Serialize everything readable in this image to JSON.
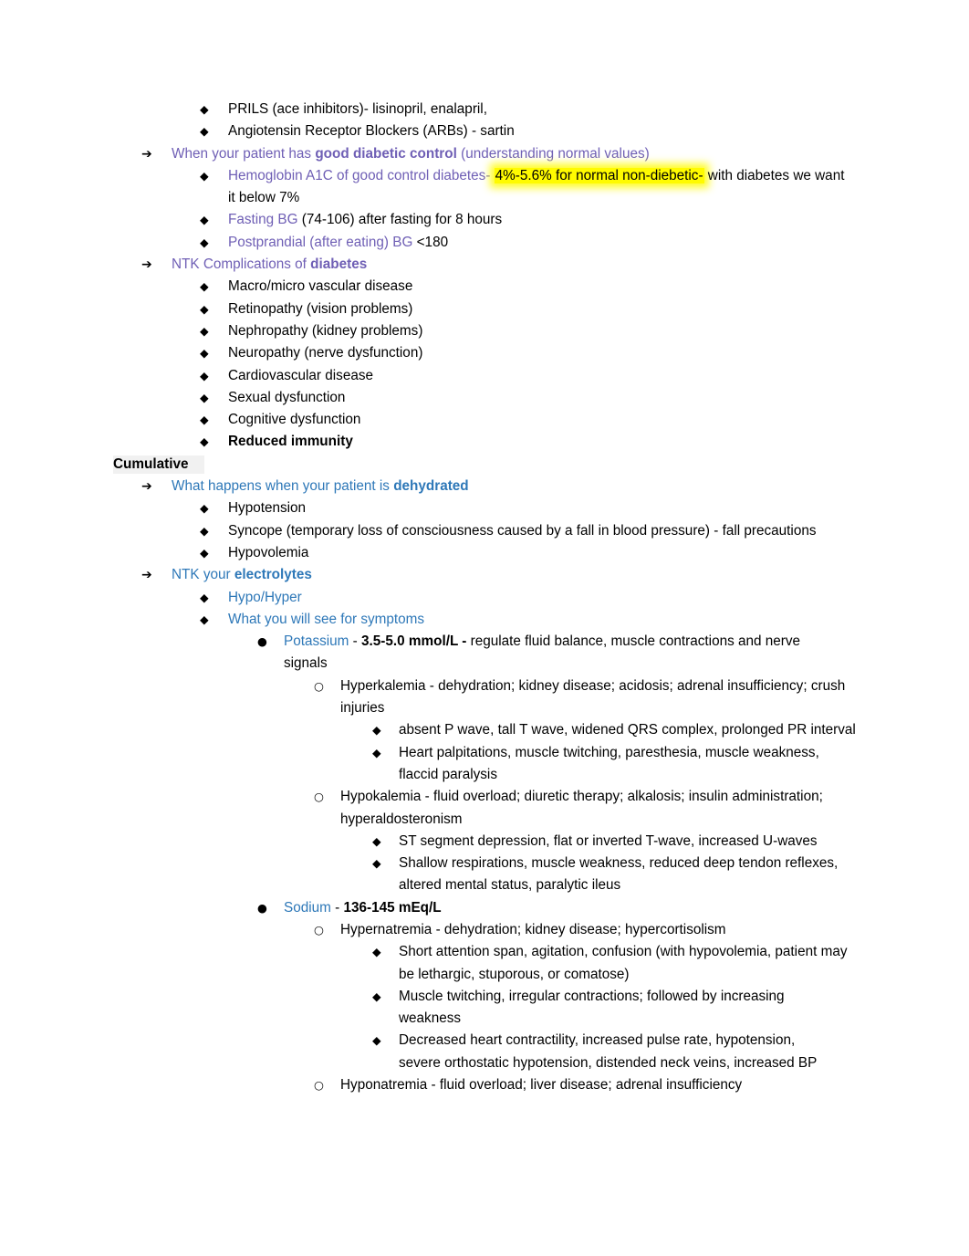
{
  "document": {
    "colors": {
      "purple": "#6f5fb5",
      "blue": "#2e78b8",
      "highlight_yellow": "#fffb00",
      "heading_shade": "#f1f1f1",
      "text": "#000000"
    },
    "markers": {
      "arrow": "➔",
      "diamond": "◆",
      "filled_circle": "●",
      "hollow_circle": "○"
    },
    "lines": {
      "prils": "PRILS (ace inhibitors)- lisinopril, enalapril,",
      "arbs": "Angiotensin Receptor Blockers (ARBs) - sartin",
      "good_control_a": "When your patient has ",
      "good_control_b": "good diabetic control",
      "good_control_c": " (understanding normal values)",
      "a1c_a": "Hemoglobin A1C of good control diabetes- ",
      "a1c_highlight": "4%-5.6% for normal non-diebetic-",
      "a1c_b": " with diabetes we want it below 7%",
      "fasting_a": "Fasting BG",
      "fasting_b": " (74-106) after fasting for 8 hours",
      "postprandial_a": "Postprandial (after eating) BG",
      "postprandial_b": " <180",
      "ntk_complications_a": "NTK Complications of ",
      "ntk_complications_b": "diabetes",
      "macro_micro": "Macro/micro vascular disease",
      "retinopathy": "Retinopathy (vision problems)",
      "nephropathy": "Nephropathy (kidney problems)",
      "neuropathy": "Neuropathy (nerve dysfunction)",
      "cardiovascular": "Cardiovascular disease",
      "sexual_dysfunction": "Sexual dysfunction",
      "cognitive_dysfunction": "Cognitive dysfunction",
      "reduced_immunity": "Reduced immunity",
      "cumulative": "Cumulative",
      "dehydrated_a": "What happens when your patient is ",
      "dehydrated_b": "dehydrated",
      "hypotension": "Hypotension",
      "syncope": "Syncope (temporary loss of consciousness caused by a fall in blood pressure) - fall precautions",
      "hypovolemia": "Hypovolemia",
      "ntk_electrolytes_a": "NTK your ",
      "ntk_electrolytes_b": "electrolytes",
      "hypo_hyper": "Hypo/Hyper",
      "what_you_see": "What you will see for symptoms",
      "potassium_name": "Potassium",
      "potassium_sep": " - ",
      "potassium_range": "3.5-5.0 mmol/L -",
      "potassium_desc": " regulate fluid balance, muscle contractions and nerve signals",
      "hyperkalemia": "Hyperkalemia - dehydration; kidney disease; acidosis; adrenal insufficiency; crush injuries",
      "hyperkalemia_ecg": "absent P wave, tall T wave, widened QRS complex, prolonged PR interval",
      "hyperkalemia_sx": "Heart palpitations, muscle twitching, paresthesia, muscle weakness, flaccid paralysis",
      "hypokalemia": "Hypokalemia - fluid overload; diuretic therapy; alkalosis; insulin administration; hyperaldosteronism",
      "hypokalemia_ecg": "ST segment depression, flat or inverted T-wave, increased U-waves",
      "hypokalemia_sx": "Shallow respirations, muscle weakness, reduced deep tendon reflexes, altered mental status, paralytic ileus",
      "sodium_name": "Sodium",
      "sodium_sep": " - ",
      "sodium_range": "136-145 mEq/L",
      "hypernatremia": "Hypernatremia - dehydration; kidney disease; hypercortisolism",
      "hypernatremia_sx1": "Short attention span, agitation, confusion (with hypovolemia, patient may be lethargic, stuporous, or comatose)",
      "hypernatremia_sx2": "Muscle twitching, irregular contractions; followed by increasing weakness",
      "hypernatremia_sx3": "Decreased heart contractility, increased pulse rate, hypotension, severe orthostatic hypotension, distended neck veins, increased BP",
      "hyponatremia": "Hyponatremia - fluid overload; liver disease; adrenal insufficiency"
    }
  }
}
